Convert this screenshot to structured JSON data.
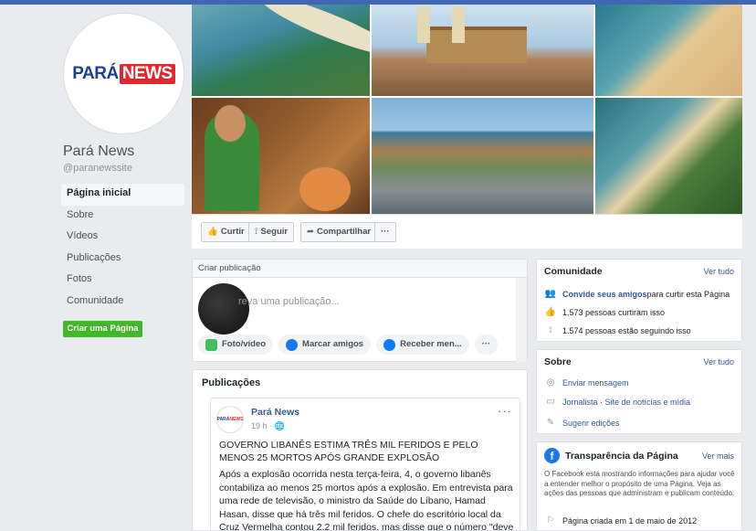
{
  "page": {
    "logo_part1": "PARÁ",
    "logo_part2": "NEWS",
    "name": "Pará News",
    "handle": "@paranewssite"
  },
  "sidebar": {
    "items": [
      {
        "label": "Página inicial",
        "active": true
      },
      {
        "label": "Sobre"
      },
      {
        "label": "Vídeos"
      },
      {
        "label": "Publicações"
      },
      {
        "label": "Fotos"
      },
      {
        "label": "Comunidade"
      }
    ],
    "create_page": "Criar uma Página"
  },
  "actions": {
    "like": "Curtir",
    "follow": "Seguir",
    "share": "Compartilhar",
    "more": "···"
  },
  "create_post": {
    "header": "Criar publicação",
    "placeholder": "reva uma publicação...",
    "options": [
      "Foto/vídeo",
      "Marcar amigos",
      "Receber men..."
    ],
    "more": "···"
  },
  "publications": {
    "title": "Publicações",
    "post": {
      "author": "Pará News",
      "time": "19 h ·",
      "headline": "GOVERNO LIBANÊS ESTIMA TRÊS MIL FERIDOS E PELO MENOS 25 MORTOS APÓS GRANDE EXPLOSÃO",
      "body": "Após a explosão ocorrida nesta terça-feira, 4, o governo libanês contabiliza ao menos 25 mortos após a explosão. Em entrevista para uma rede de televisão, o ministro da Saúde do Líbano, Hamad Hasan, disse que há três mil feridos. O chefe do escritório local da Cruz Vermelha contou 2,2 mil feridos, mas disse que o número \"deve ser"
    }
  },
  "community": {
    "title": "Comunidade",
    "link": "Ver tudo",
    "invite_link": "Convide seus amigos",
    "invite_rest": " para curtir esta Página",
    "likes": "1.573 pessoas curtiram isso",
    "followers": "1.574 pessoas estão seguindo isso"
  },
  "about": {
    "title": "Sobre",
    "link": "Ver tudo",
    "message": "Enviar mensagem",
    "category": "Jornalista · Site de notícias e mídia",
    "suggest": "Sugerir edições"
  },
  "transparency": {
    "title": "Transparência da Página",
    "link": "Ver mais",
    "desc": "O Facebook está mostrando informações para ajudar você a entender melhor o propósito de uma Página. Veja as ações das pessoas que administram e publicam conteúdo.",
    "created": "Página criada em 1 de maio de 2012"
  },
  "colors": {
    "facebook_blue": "#4267b2",
    "link_blue": "#365899",
    "green_button": "#42b72a",
    "logo_red": "#e0282e",
    "logo_blue": "#1b3f8f"
  }
}
